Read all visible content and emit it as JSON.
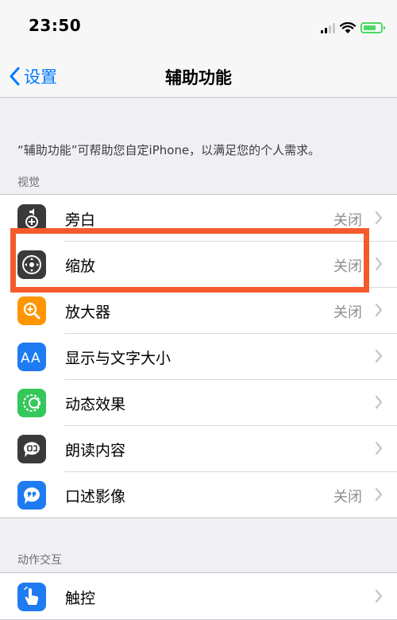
{
  "status_bar": {
    "time": "23:50"
  },
  "nav": {
    "back_label": "设置",
    "title": "辅助功能"
  },
  "description": "“辅助功能”可帮助您自定iPhone，以满足您的个人需求。",
  "sections": {
    "vision": {
      "header": "视觉",
      "items": [
        {
          "label": "旁白",
          "value": "关闭",
          "icon": "voiceover-icon",
          "color": "#3a3a3c"
        },
        {
          "label": "缩放",
          "value": "关闭",
          "icon": "zoom-icon",
          "color": "#3a3a3c"
        },
        {
          "label": "放大器",
          "value": "关闭",
          "icon": "magnifier-icon",
          "color": "#ff9500"
        },
        {
          "label": "显示与文字大小",
          "value": "",
          "icon": "text-size-icon",
          "color": "#1e7bf2"
        },
        {
          "label": "动态效果",
          "value": "",
          "icon": "motion-icon",
          "color": "#34c759"
        },
        {
          "label": "朗读内容",
          "value": "",
          "icon": "spoken-content-icon",
          "color": "#3a3a3c"
        },
        {
          "label": "口述影像",
          "value": "关闭",
          "icon": "audio-description-icon",
          "color": "#1e7bf2"
        }
      ]
    },
    "interaction": {
      "header": "动作交互",
      "items": [
        {
          "label": "触控",
          "value": "",
          "icon": "touch-icon",
          "color": "#1e7bf2"
        }
      ]
    }
  },
  "colors": {
    "accent": "#007aff",
    "highlight": "#f55a2c",
    "background": "#efeff4"
  }
}
